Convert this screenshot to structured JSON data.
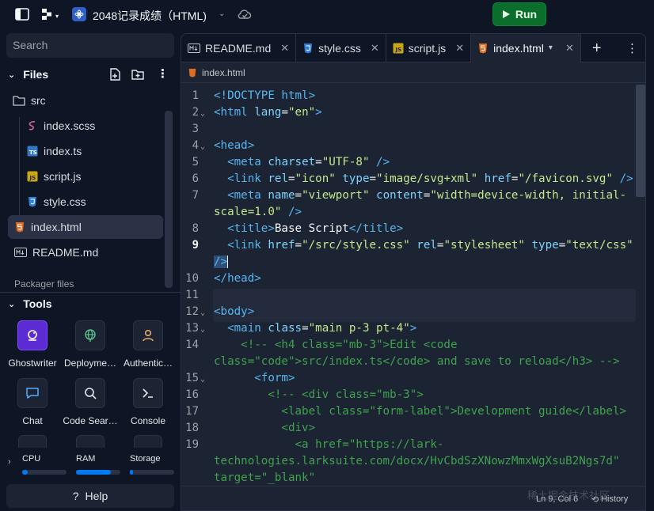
{
  "topbar": {
    "repl_title": "2048记录成绩（HTML)",
    "run_label": "Run"
  },
  "sidebar": {
    "search_placeholder": "Search",
    "files_title": "Files",
    "tree": [
      {
        "name": "src",
        "icon": "folder-icon"
      },
      {
        "name": "index.scss",
        "icon": "sass-file-icon"
      },
      {
        "name": "index.ts",
        "icon": "typescript-file-icon"
      },
      {
        "name": "script.js",
        "icon": "javascript-file-icon"
      },
      {
        "name": "style.css",
        "icon": "css-file-icon"
      },
      {
        "name": "index.html",
        "icon": "html-file-icon"
      },
      {
        "name": "README.md",
        "icon": "markdown-file-icon"
      }
    ],
    "packager_label": "Packager files",
    "tools_title": "Tools",
    "tools": [
      {
        "label": "Ghostwriter",
        "icon": "ghostwriter-icon"
      },
      {
        "label": "Deployme…",
        "icon": "globe-icon"
      },
      {
        "label": "Authentic…",
        "icon": "user-icon"
      },
      {
        "label": "Chat",
        "icon": "chat-bubble-icon"
      },
      {
        "label": "Code Sear…",
        "icon": "search-icon"
      },
      {
        "label": "Console",
        "icon": "terminal-icon"
      }
    ],
    "resources": [
      {
        "label": "CPU",
        "level": 0.12
      },
      {
        "label": "RAM",
        "level": 0.78
      },
      {
        "label": "Storage",
        "level": 0.08
      }
    ],
    "help_label": "Help"
  },
  "editor": {
    "tabs": [
      {
        "label": "README.md",
        "icon": "markdown-file-icon"
      },
      {
        "label": "style.css",
        "icon": "css-file-icon"
      },
      {
        "label": "script.js",
        "icon": "javascript-file-icon"
      },
      {
        "label": "index.html",
        "icon": "html-file-icon"
      }
    ],
    "breadcrumb": "index.html",
    "line_numbers": [
      "1",
      "2",
      "3",
      "4",
      "5",
      "6",
      "7",
      "8",
      "9",
      "10",
      "11",
      "12",
      "13",
      "14",
      "15",
      "16",
      "17",
      "18",
      "19"
    ],
    "status_text": "Ln 9, Col 6",
    "history_label": "History"
  },
  "watermark": "稀土掘金技术社区",
  "colors": {
    "background": "#0e1525",
    "panel": "#1c2333",
    "run_green": "#0b6e2a",
    "accent_blue": "#0079f2"
  }
}
